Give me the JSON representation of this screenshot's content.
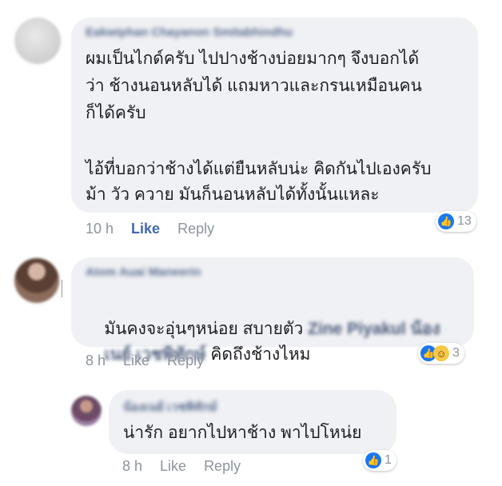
{
  "comments": [
    {
      "author": "Eakwiphan Chayanon Smitabhindhu",
      "lines": [
        "ผมเป็นไกด์ครับ ไปปางช้างบ่อยมากๆ จึงบอกได้",
        "ว่า ช้างนอนหลับได้ แถมหาวและกรนเหมือนคน",
        "ก็ได้ครับ",
        "",
        "ไอ้ที่บอกว่าช้างได้แต่ยืนหลับน่ะ คิดกันไปเองครับ",
        "ม้า วัว ควาย มันก็นอนหลับได้ทั้งนั้นแหละ"
      ],
      "time": "10 h",
      "like_label": "Like",
      "reply_label": "Reply",
      "reaction_count": "13"
    },
    {
      "author": "Atom Auai Maneerin",
      "line1": "มันคงจะอุ่นๆหน่อย สบายตัว",
      "tag_part1": "Zine Piyakul น้อง",
      "tag_part2": "เนย์ เวชพิทักษ์",
      "line2_rest": "คิดถึงช้างไหม",
      "time": "8 h",
      "like_label": "Like",
      "reply_label": "Reply",
      "reaction_count": "3"
    },
    {
      "author": "น้องเนย์ เวชพิทักษ์",
      "text": "น่ารัก อยากไปหาช้าง พาไปโหน่ย",
      "time": "8 h",
      "like_label": "Like",
      "reply_label": "Reply",
      "reaction_count": "1"
    }
  ],
  "icons": {
    "like": "thumbs-up-icon",
    "haha": "laugh-face-icon"
  },
  "colors": {
    "like_blue": "#4267b2",
    "reaction_blue": "#1877f2",
    "bubble": "#f0f1f4"
  }
}
